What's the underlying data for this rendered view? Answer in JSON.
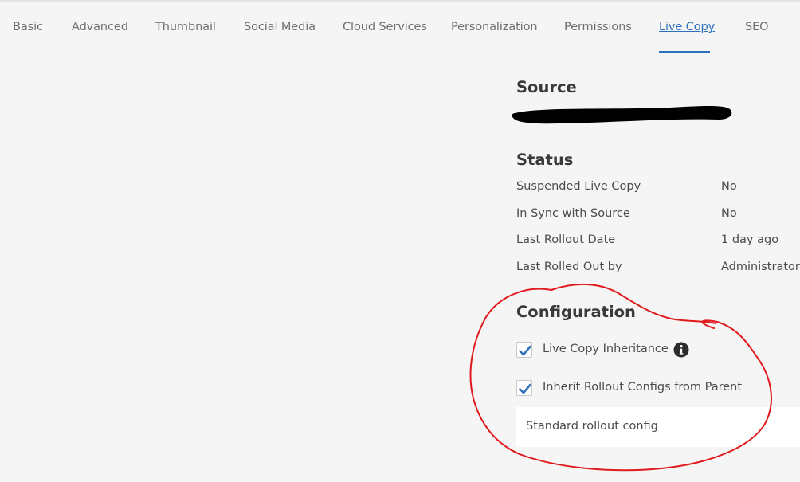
{
  "tabs": [
    {
      "label": "Basic",
      "active": false
    },
    {
      "label": "Advanced",
      "active": false
    },
    {
      "label": "Thumbnail",
      "active": false
    },
    {
      "label": "Social Media",
      "active": false
    },
    {
      "label": "Cloud Services",
      "active": false
    },
    {
      "label": "Personalization",
      "active": false
    },
    {
      "label": "Permissions",
      "active": false
    },
    {
      "label": "Live Copy",
      "active": true
    },
    {
      "label": "SEO",
      "active": false
    }
  ],
  "source": {
    "title": "Source"
  },
  "status": {
    "title": "Status",
    "rows": [
      {
        "label": "Suspended Live Copy",
        "value": "No"
      },
      {
        "label": "In Sync with Source",
        "value": "No"
      },
      {
        "label": "Last Rollout Date",
        "value": "1 day ago"
      },
      {
        "label": "Last Rolled Out by",
        "value": "Administrator"
      }
    ]
  },
  "configuration": {
    "title": "Configuration",
    "live_copy_inheritance": {
      "label": "Live Copy Inheritance",
      "checked": true
    },
    "inherit_rollout": {
      "label": "Inherit Rollout Configs from Parent",
      "checked": true
    },
    "rollout_config": "Standard rollout config"
  },
  "colors": {
    "accent": "#2c6fbd",
    "checkmark": "#2c6fbd",
    "annotation": "#e0191d",
    "background": "#f5f5f5"
  },
  "icons": {
    "info": "info-icon",
    "check": "checkmark-icon"
  }
}
